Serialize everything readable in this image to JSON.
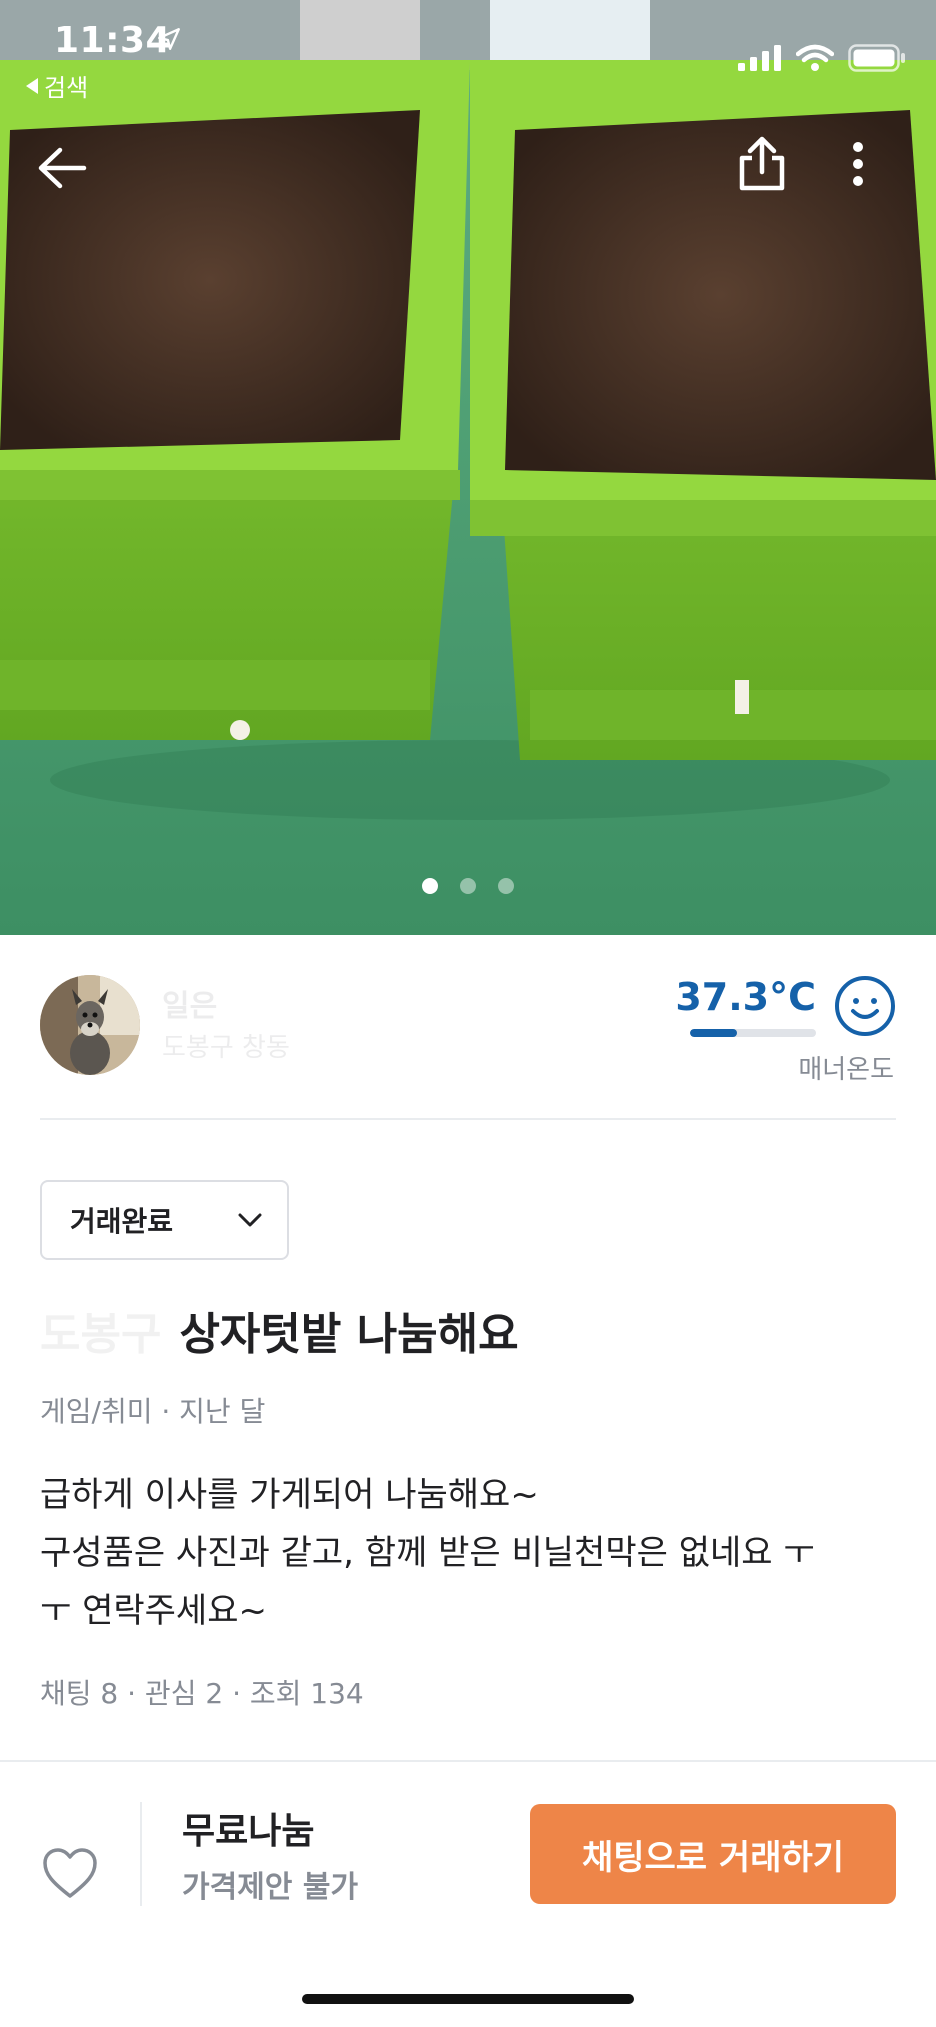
{
  "status_bar": {
    "time": "11:34",
    "back_app_label": "검색"
  },
  "image_carousel": {
    "total": 3,
    "active_index": 0
  },
  "seller": {
    "name": "일은",
    "location": "도봉구 창동"
  },
  "manner": {
    "temperature": "37.3°C",
    "level": 0.373,
    "label": "매너온도",
    "color": "#1561a9"
  },
  "post": {
    "status": "거래완료",
    "title_prefix": "도봉구",
    "title": "상자텃밭 나눔해요",
    "meta": "게임/취미 · 지난 달",
    "description_lines": [
      "급하게 이사를 가게되어 나눔해요~",
      "구성품은 사진과 같고, 함께 받은 비닐천막은 없네요 ㅜ",
      "ㅜ 연락주세요~"
    ],
    "stats": "채팅 8 · 관심 2 · 조회 134"
  },
  "bottom_bar": {
    "price": "무료나눔",
    "negotiation": "가격제안 불가",
    "chat_button": "채팅으로 거래하기",
    "accent": "#ee8548"
  },
  "icons": [
    "back-arrow-icon",
    "share-icon",
    "more-vertical-icon",
    "heart-icon",
    "chevron-down-icon",
    "smile-face-icon",
    "location-arrow-icon",
    "signal-icon",
    "wifi-icon",
    "battery-icon"
  ]
}
